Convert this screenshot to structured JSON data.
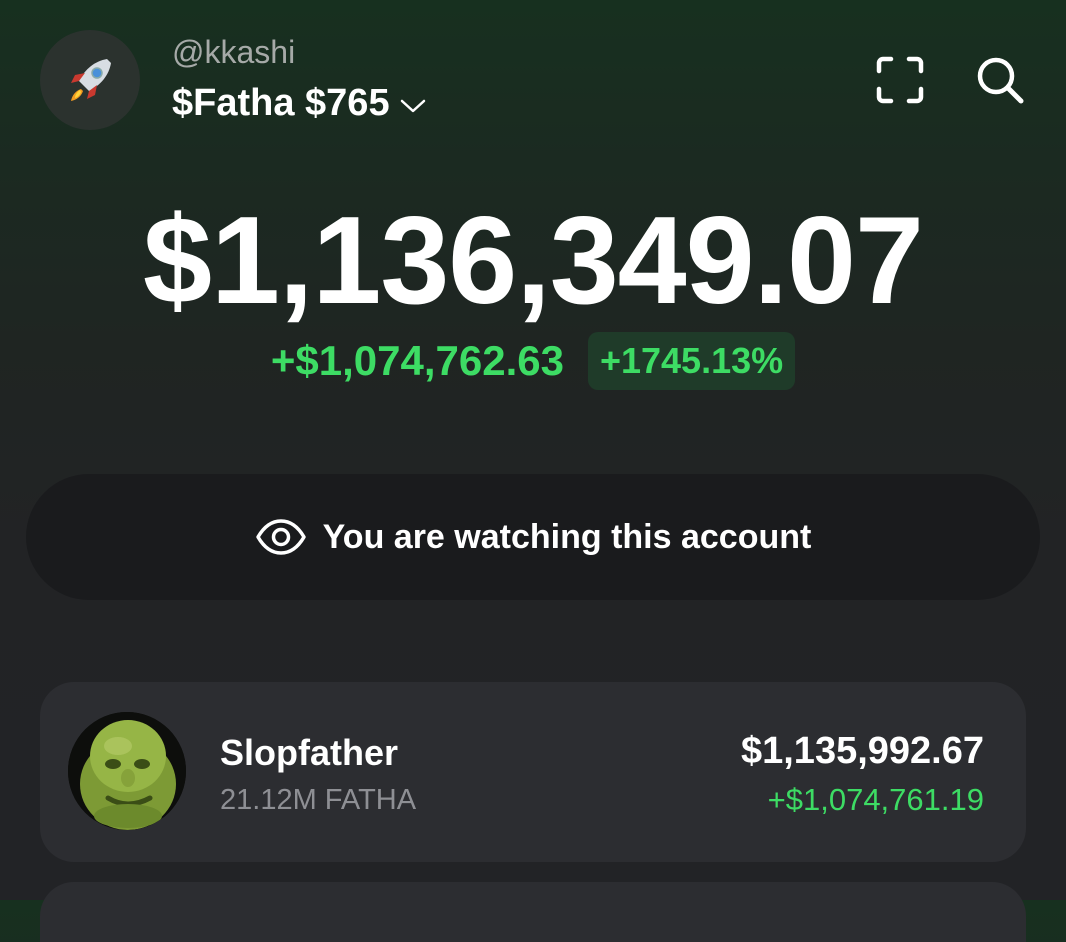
{
  "header": {
    "avatar_icon": "rocket-icon",
    "handle": "@kkashi",
    "account_name": "$Fatha $765",
    "scan_icon": "scan-icon",
    "search_icon": "search-icon"
  },
  "portfolio": {
    "balance": "$1,136,349.07",
    "change_abs": "+$1,074,762.63",
    "change_pct": "+1745.13%"
  },
  "watch_banner": {
    "icon": "eye-icon",
    "text": "You are watching this account"
  },
  "tokens": [
    {
      "name": "Slopfather",
      "quantity": "21.12M FATHA",
      "value": "$1,135,992.67",
      "change": "+$1,074,761.19"
    }
  ],
  "colors": {
    "positive": "#3ddc64",
    "background": "#222326",
    "card": "#2c2d31"
  }
}
